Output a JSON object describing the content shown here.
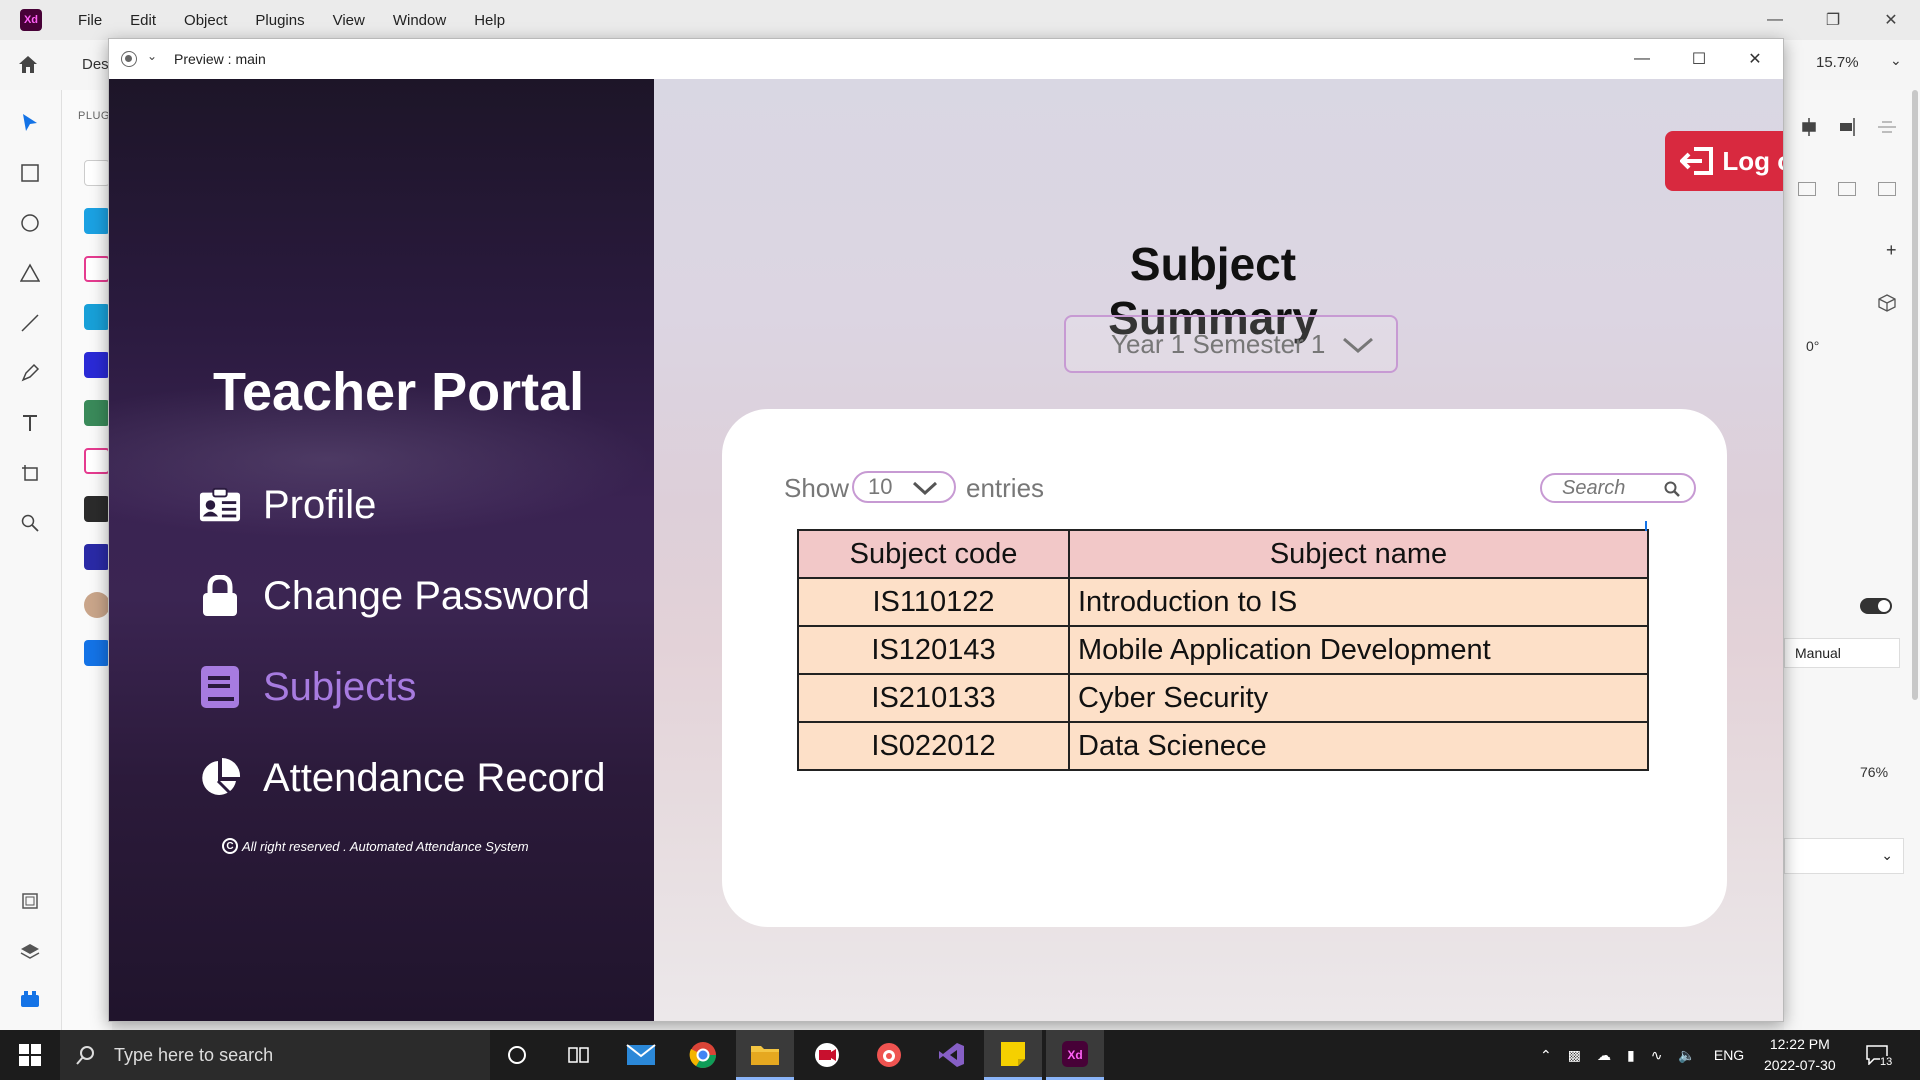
{
  "xd": {
    "logo": "Xd",
    "menu": [
      "File",
      "Edit",
      "Object",
      "Plugins",
      "View",
      "Window",
      "Help"
    ],
    "design_tab": "Des",
    "zoom": "15.7%",
    "plugins_label": "PLUG",
    "right_panel": {
      "rotation": "0°",
      "mode": "Manual",
      "opacity": "76%"
    }
  },
  "preview": {
    "title": "Preview : main"
  },
  "app": {
    "portal_title": "Teacher Portal",
    "nav": [
      {
        "label": "Profile",
        "icon": "id-card-icon",
        "active": false
      },
      {
        "label": "Change Password",
        "icon": "lock-icon",
        "active": false
      },
      {
        "label": "Subjects",
        "icon": "book-icon",
        "active": true
      },
      {
        "label": "Attendance Record",
        "icon": "pie-chart-icon",
        "active": false
      }
    ],
    "copyright": "All right reserved . Automated Attendance System",
    "logout_label": "Log out",
    "summary_title": "Subject Summary",
    "semester": "Year 1 Semester 1",
    "show_label": "Show",
    "entries_value": "10",
    "entries_label": "entries",
    "search_placeholder": "Search",
    "table": {
      "headers": [
        "Subject code",
        "Subject name"
      ],
      "rows": [
        {
          "code": "IS110122",
          "name": "Introduction to IS"
        },
        {
          "code": "IS120143",
          "name": "Mobile Application Development"
        },
        {
          "code": "IS210133",
          "name": "Cyber Security"
        },
        {
          "code": "IS022012",
          "name": "Data Scienece"
        }
      ]
    },
    "colors": {
      "accent": "#a77be0",
      "logout": "#d8293f",
      "header_row": "#f2c8c8",
      "body_row": "#fde0c8"
    }
  },
  "taskbar": {
    "search_placeholder": "Type here to search",
    "language": "ENG",
    "time": "12:22 PM",
    "date": "2022-07-30",
    "notifications": "13"
  }
}
